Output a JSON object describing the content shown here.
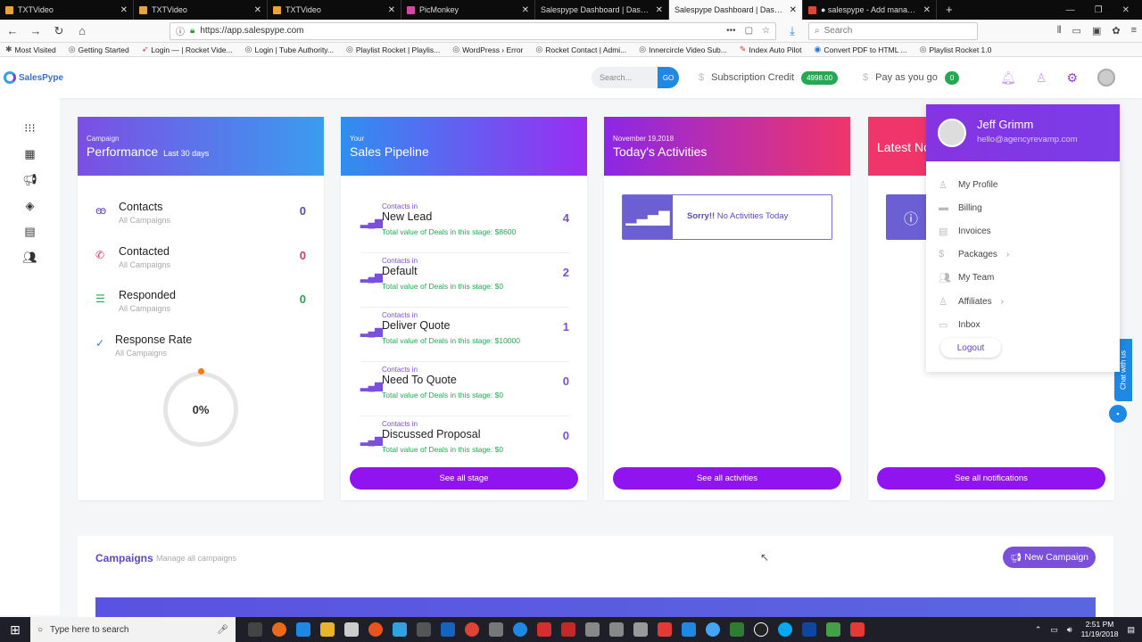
{
  "browser": {
    "tabs": [
      {
        "title": "TXTVideo"
      },
      {
        "title": "TXTVideo"
      },
      {
        "title": "TXTVideo"
      },
      {
        "title": "PicMonkey"
      },
      {
        "title": "Salespype Dashboard | Dashboard"
      },
      {
        "title": "Salespype Dashboard | Dashboard"
      },
      {
        "title": "● salespype - Add managers a..."
      }
    ],
    "url": "https://app.salespype.com",
    "search_placeholder": "Search",
    "bookmarks": [
      "Most Visited",
      "Getting Started",
      "Login — | Rocket Vide...",
      "Login | Tube Authority...",
      "Playlist Rocket | Playlis...",
      "WordPress › Error",
      "Rocket Contact | Admi...",
      "Innercircle Video Sub...",
      "Index Auto Pilot",
      "Convert PDF to HTML ...",
      "Playlist Rocket 1.0"
    ]
  },
  "header": {
    "logo": "SalesPype",
    "search_placeholder": "Search...",
    "go_label": "GO",
    "credit_label": "Subscription Credit",
    "credit_value": "4998.00",
    "payg_label": "Pay as you go",
    "payg_value": "0"
  },
  "performance": {
    "small": "Campaign",
    "title": "Performance",
    "range": "Last 30 days",
    "rows": [
      {
        "label": "Contacts",
        "sub": "All Campaigns",
        "value": "0"
      },
      {
        "label": "Contacted",
        "sub": "All Campaigns",
        "value": "0"
      },
      {
        "label": "Responded",
        "sub": "All Campaigns",
        "value": "0"
      },
      {
        "label": "Response Rate",
        "sub": "All Campaigns"
      }
    ],
    "rate": "0%"
  },
  "pipeline": {
    "small": "Your",
    "title": "Sales Pipeline",
    "stages": [
      {
        "small": "Contacts in",
        "name": "New Lead",
        "total": "Total value of Deals in this stage: $8600",
        "count": "4"
      },
      {
        "small": "Contacts in",
        "name": "Default",
        "total": "Total value of Deals in this stage: $0",
        "count": "2"
      },
      {
        "small": "Contacts in",
        "name": "Deliver Quote",
        "total": "Total value of Deals in this stage: $10000",
        "count": "1"
      },
      {
        "small": "Contacts in",
        "name": "Need To Quote",
        "total": "Total value of Deals in this stage: $0",
        "count": "0"
      },
      {
        "small": "Contacts in",
        "name": "Discussed Proposal",
        "total": "Total value of Deals in this stage: $0",
        "count": "0"
      }
    ],
    "button": "See all stage"
  },
  "activities": {
    "small": "November 19,2018",
    "title": "Today's Activities",
    "sorry_bold": "Sorry!!",
    "sorry_text": "No Activities Today",
    "button": "See all activities"
  },
  "notifications": {
    "title": "Latest No",
    "button": "See all notifications"
  },
  "user_menu": {
    "name": "Jeff Grimm",
    "email": "hello@agencyrevamp.com",
    "items": [
      "My Profile",
      "Billing",
      "Invoices",
      "Packages",
      "My Team",
      "Affiliates",
      "Inbox"
    ],
    "logout": "Logout"
  },
  "chat": {
    "label": "Chat with us"
  },
  "campaigns": {
    "title": "Campaigns",
    "subtitle": "Manage all campaigns",
    "new_button": "New Campaign"
  },
  "taskbar": {
    "search_placeholder": "Type here to search",
    "time": "2:51 PM",
    "date": "11/19/2018"
  },
  "colors": {
    "accent": "#9014f0",
    "brand": "#7a4fd9",
    "green": "#22a952",
    "red": "#f0356a"
  }
}
